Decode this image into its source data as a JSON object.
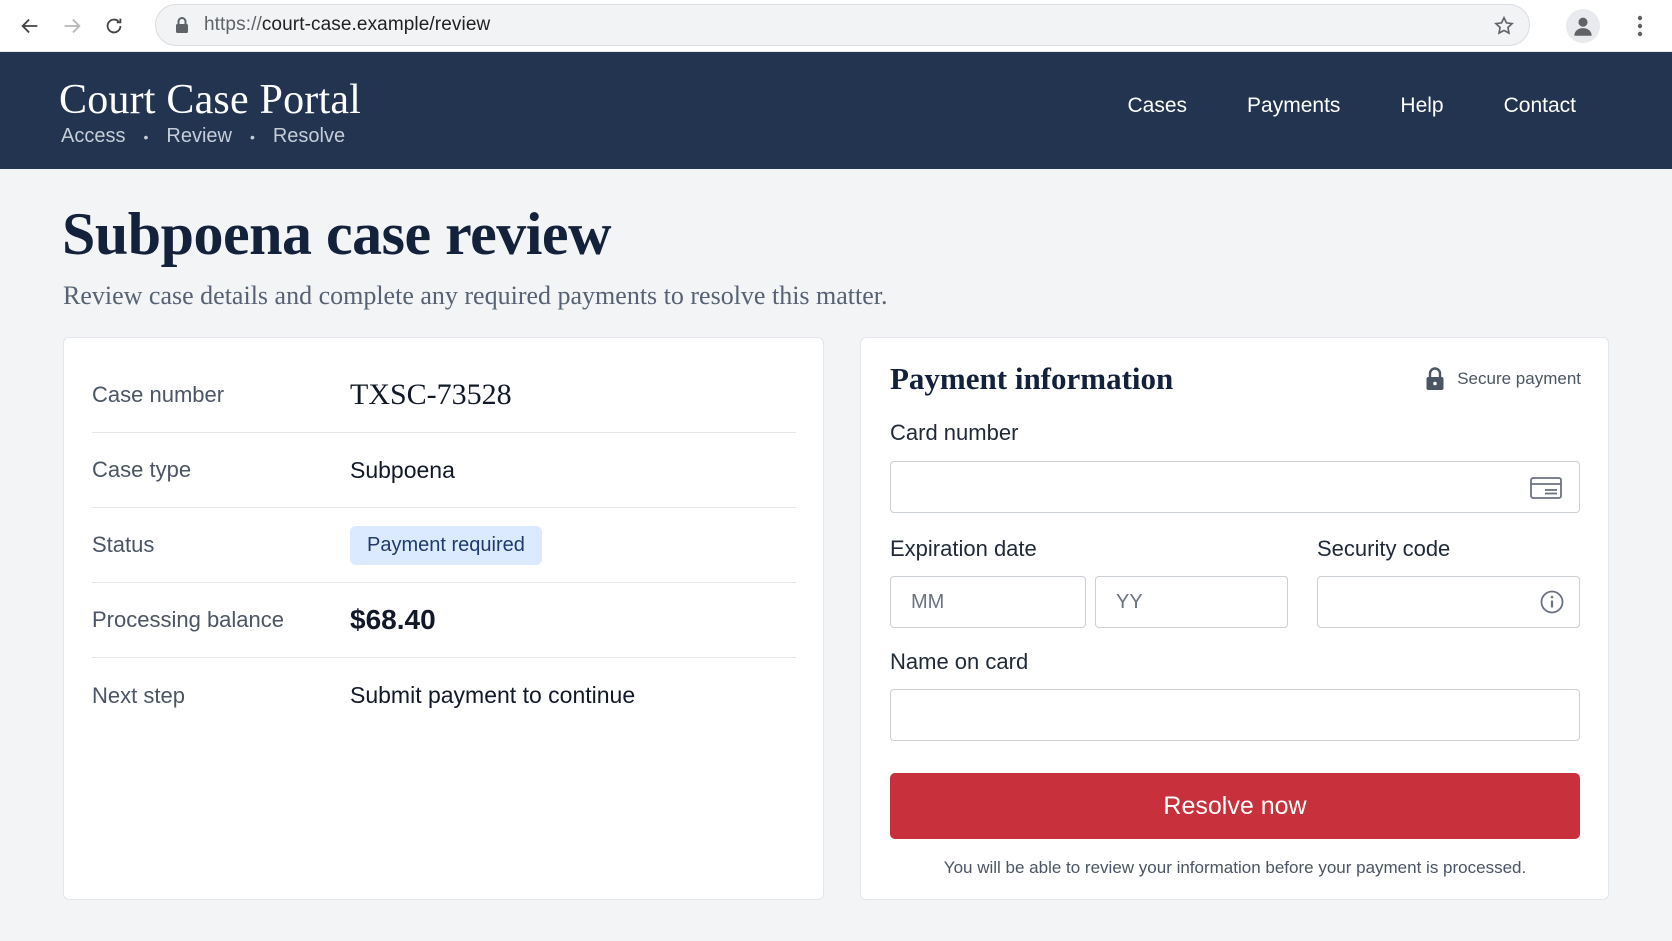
{
  "browser": {
    "url_scheme": "https://",
    "url_rest": "court-case.example/review"
  },
  "header": {
    "title": "Court Case Portal",
    "tagline": [
      "Access",
      "Review",
      "Resolve"
    ],
    "nav": [
      "Cases",
      "Payments",
      "Help",
      "Contact"
    ]
  },
  "page": {
    "title": "Subpoena case review",
    "subtitle": "Review case details and complete any required payments to resolve this matter."
  },
  "details": {
    "rows": [
      {
        "label": "Case number",
        "value": "TXSC-73528"
      },
      {
        "label": "Case type",
        "value": "Subpoena"
      },
      {
        "label": "Status",
        "value": "Payment required"
      },
      {
        "label": "Processing balance",
        "value": "$68.40"
      },
      {
        "label": "Next step",
        "value": "Submit payment to continue"
      }
    ]
  },
  "payment": {
    "title": "Payment information",
    "secure_label": "Secure payment",
    "card_number_label": "Card number",
    "card_number_value": "",
    "expiration_label": "Expiration date",
    "month_placeholder": "MM",
    "year_placeholder": "YY",
    "security_code_label": "Security code",
    "security_code_value": "",
    "name_label": "Name on card",
    "name_value": "",
    "submit_label": "Resolve now",
    "note": "You will be able to review your information before your payment is processed."
  },
  "colors": {
    "header_bg": "#22344f",
    "accent_red": "#c8313b",
    "badge_bg": "#dbeafe",
    "title_navy": "#14213a"
  },
  "icons": [
    "back-icon",
    "forward-icon",
    "reload-icon",
    "lock-icon",
    "star-icon",
    "profile-icon",
    "kebab-menu-icon",
    "padlock-icon",
    "credit-card-icon",
    "info-icon"
  ]
}
